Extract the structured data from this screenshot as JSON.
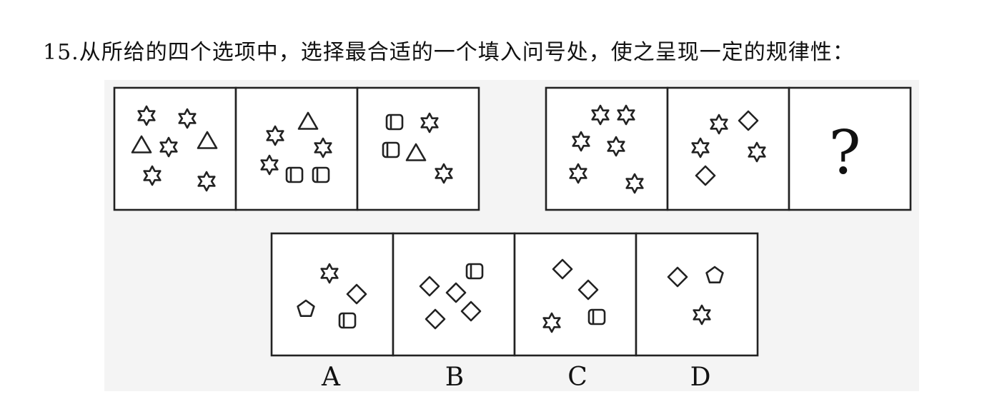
{
  "question": {
    "number": "15.",
    "text": "从所给的四个选项中，选择最合适的一个填入问号处，使之呈现一定的规律性："
  },
  "puzzle": {
    "question_mark": "?",
    "panel_shapes": [
      [
        "star",
        "star",
        "triangle",
        "star",
        "triangle",
        "star",
        "star"
      ],
      [
        "triangle",
        "star",
        "star",
        "star",
        "rounded-square",
        "rounded-square"
      ],
      [
        "rounded-square",
        "star",
        "rounded-square",
        "triangle",
        "star"
      ],
      [
        "star",
        "star",
        "star",
        "star",
        "star",
        "star"
      ],
      [
        "star",
        "diamond",
        "star",
        "star",
        "diamond"
      ]
    ]
  },
  "options": [
    {
      "label": "A",
      "shapes": [
        "star",
        "diamond",
        "pentagon",
        "rounded-square"
      ]
    },
    {
      "label": "B",
      "shapes": [
        "diamond",
        "rounded-square",
        "diamond",
        "diamond",
        "diamond"
      ]
    },
    {
      "label": "C",
      "shapes": [
        "diamond",
        "diamond",
        "star",
        "rounded-square"
      ]
    },
    {
      "label": "D",
      "shapes": [
        "diamond",
        "pentagon",
        "star"
      ]
    }
  ]
}
